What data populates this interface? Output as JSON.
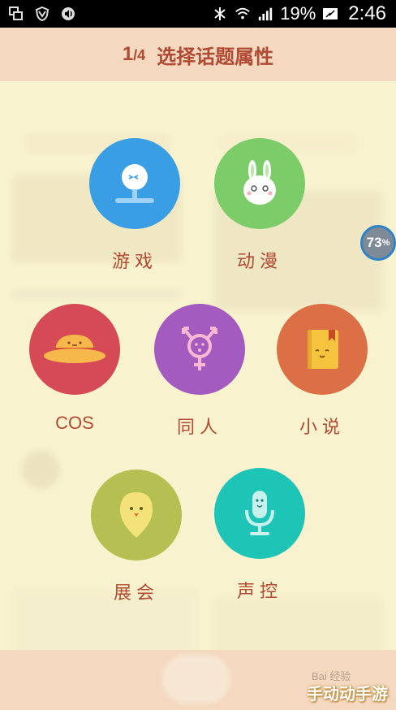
{
  "status_bar": {
    "icons": [
      "window-icon",
      "shield-icon",
      "volume-icon",
      "bluetooth-icon",
      "wifi-icon",
      "signal-icon",
      "battery-icon"
    ],
    "battery_percent": "19%",
    "time": "2:46"
  },
  "header": {
    "step_current": "1",
    "step_total": "/4",
    "title": "选择话题属性"
  },
  "categories": [
    {
      "label": "游戏",
      "icon": "game-face-icon",
      "color": "#3a9ee4"
    },
    {
      "label": "动漫",
      "icon": "bunny-icon",
      "color": "#7ccd6a"
    },
    {
      "label": "COS",
      "icon": "hat-icon",
      "color": "#d54a55"
    },
    {
      "label": "同人",
      "icon": "gender-icon",
      "color": "#a35bc0"
    },
    {
      "label": "小说",
      "icon": "book-icon",
      "color": "#dc6f45"
    },
    {
      "label": "展会",
      "icon": "location-pin-icon",
      "color": "#b5bf52"
    },
    {
      "label": "声控",
      "icon": "microphone-icon",
      "color": "#1ec4b6"
    }
  ],
  "progress_badge": {
    "value": "73",
    "unit": "%"
  },
  "watermark": {
    "text": "手动动手游",
    "baidu": "Bai 经验"
  }
}
